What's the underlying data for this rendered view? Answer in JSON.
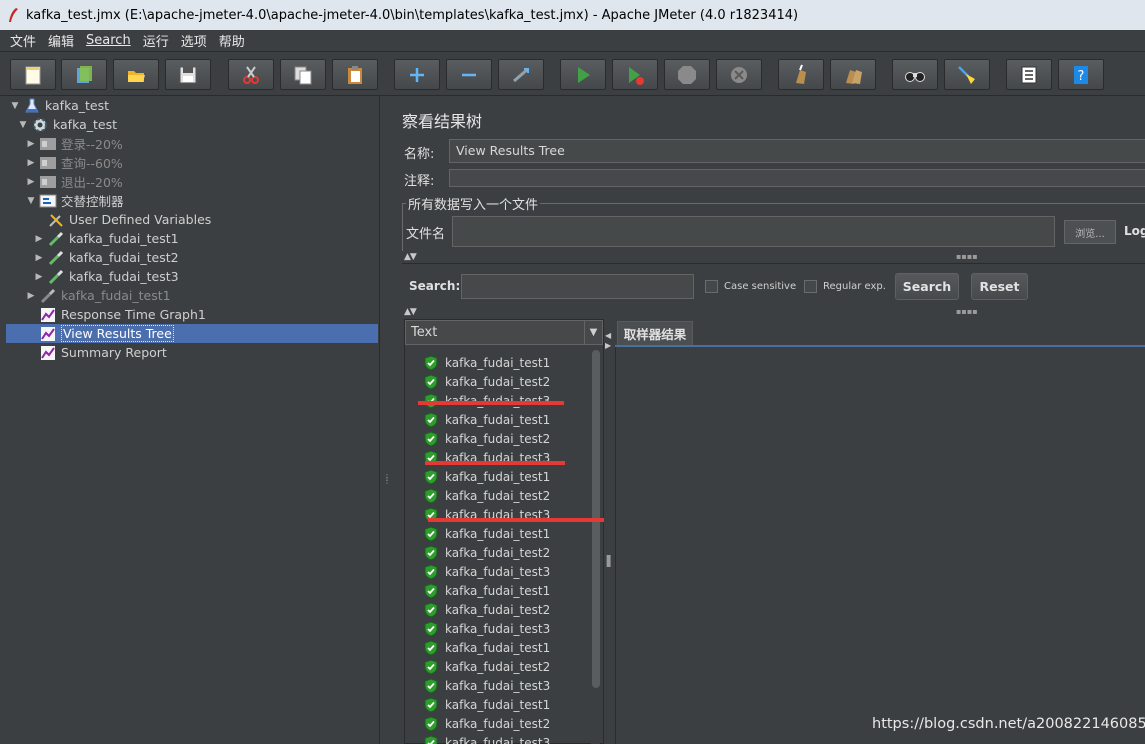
{
  "window": {
    "title": "kafka_test.jmx (E:\\apache-jmeter-4.0\\apache-jmeter-4.0\\bin\\templates\\kafka_test.jmx) - Apache JMeter (4.0 r1823414)"
  },
  "menu": {
    "file": "文件",
    "edit": "编辑",
    "search": "Search",
    "run": "运行",
    "options": "选项",
    "help": "帮助"
  },
  "toolbar": {
    "icons": [
      "new-icon",
      "templates-icon",
      "open-icon",
      "save-icon",
      "cut-icon",
      "copy-icon",
      "paste-icon",
      "expand-icon",
      "collapse-icon",
      "toggle-icon",
      "start-icon",
      "start-no-pause-icon",
      "stop-icon",
      "shutdown-icon",
      "clear-icon",
      "clear-all-icon",
      "search-icon",
      "reset-search-icon",
      "function-helper-icon",
      "help-icon"
    ]
  },
  "tree": {
    "items": [
      {
        "label": "kafka_test",
        "icon": "test-plan-icon",
        "indent": 0,
        "expanded": true
      },
      {
        "label": "kafka_test",
        "icon": "thread-group-icon",
        "indent": 1,
        "expanded": true
      },
      {
        "label": "登录--20%",
        "icon": "controller-icon",
        "indent": 2,
        "collapsed": true,
        "disabled": true
      },
      {
        "label": "查询--60%",
        "icon": "controller-icon",
        "indent": 2,
        "collapsed": true,
        "disabled": true
      },
      {
        "label": "退出--20%",
        "icon": "controller-icon",
        "indent": 2,
        "collapsed": true,
        "disabled": true
      },
      {
        "label": "交替控制器",
        "icon": "interleave-controller-icon",
        "indent": 2,
        "expanded": true
      },
      {
        "label": "User Defined Variables",
        "icon": "config-element-icon",
        "indent": 3
      },
      {
        "label": "kafka_fudai_test1",
        "icon": "sampler-icon",
        "indent": 3,
        "collapsed": true
      },
      {
        "label": "kafka_fudai_test2",
        "icon": "sampler-icon",
        "indent": 3,
        "collapsed": true
      },
      {
        "label": "kafka_fudai_test3",
        "icon": "sampler-icon",
        "indent": 3,
        "collapsed": true
      },
      {
        "label": "kafka_fudai_test1",
        "icon": "sampler-icon",
        "indent": 2,
        "collapsed": true,
        "disabled": true
      },
      {
        "label": "Response Time Graph1",
        "icon": "listener-icon",
        "indent": 2
      },
      {
        "label": "View Results Tree",
        "icon": "listener-icon",
        "indent": 2,
        "selected": true
      },
      {
        "label": "Summary Report",
        "icon": "listener-icon",
        "indent": 2
      }
    ]
  },
  "panel": {
    "title": "察看结果树",
    "name_label": "名称:",
    "name_value": "View Results Tree",
    "comment_label": "注释:",
    "comment_value": "",
    "file_group_title": "所有数据写入一个文件",
    "filename_label": "文件名",
    "filename_value": "",
    "browse_label": "浏览...",
    "log_label": "Log"
  },
  "search": {
    "label": "Search:",
    "value": "",
    "case_sensitive_label": "Case sensitive",
    "case_sensitive_checked": false,
    "regex_label": "Regular exp.",
    "regex_checked": false,
    "search_button": "Search",
    "reset_button": "Reset"
  },
  "results": {
    "renderer": "Text",
    "items": [
      "kafka_fudai_test1",
      "kafka_fudai_test2",
      "kafka_fudai_test3",
      "kafka_fudai_test1",
      "kafka_fudai_test2",
      "kafka_fudai_test3",
      "kafka_fudai_test1",
      "kafka_fudai_test2",
      "kafka_fudai_test3",
      "kafka_fudai_test1",
      "kafka_fudai_test2",
      "kafka_fudai_test3",
      "kafka_fudai_test1",
      "kafka_fudai_test2",
      "kafka_fudai_test3",
      "kafka_fudai_test1",
      "kafka_fudai_test2",
      "kafka_fudai_test3",
      "kafka_fudai_test1",
      "kafka_fudai_test2",
      "kafka_fudai_test3"
    ],
    "status": "success",
    "sampler_tab": "取样器结果"
  },
  "watermark": "https://blog.csdn.net/a200822146085",
  "colors": {
    "background": "#3c3f41",
    "selection": "#4b6eaf",
    "success": "#2e9d2e",
    "annotation": "#e53935"
  }
}
